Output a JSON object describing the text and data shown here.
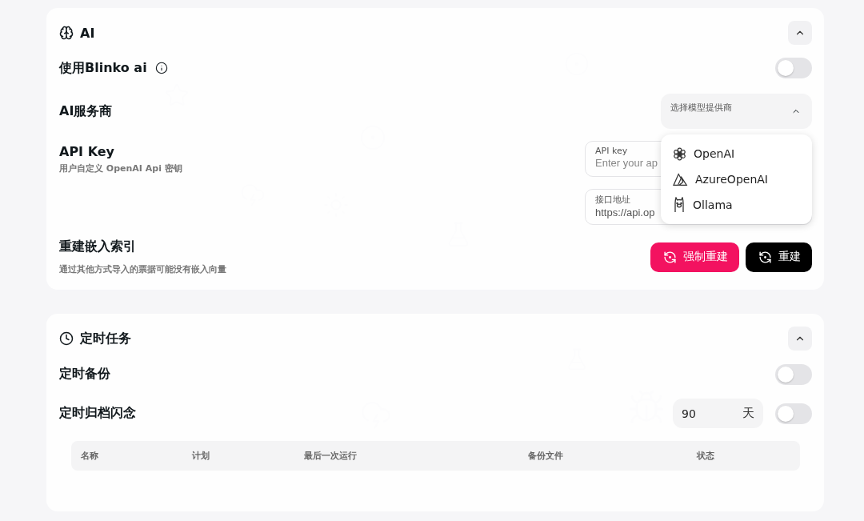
{
  "ai_section": {
    "title": "AI",
    "expanded": true,
    "use_blinko": {
      "label": "使用Blinko ai",
      "on": false
    },
    "provider": {
      "label": "AI服务商",
      "select_label": "选择模型提供商",
      "open": true,
      "options": [
        {
          "kind": "openai",
          "label": "OpenAI"
        },
        {
          "kind": "azure",
          "label": "AzureOpenAI"
        },
        {
          "kind": "ollama",
          "label": "Ollama"
        }
      ]
    },
    "api_key": {
      "label": "API Key",
      "description": "用户自定义 OpenAI Api 密钥",
      "key_field": {
        "label": "API key",
        "placeholder": "Enter your ap"
      },
      "endpoint_field": {
        "label": "接口地址",
        "value": "https://api.op"
      }
    },
    "rebuild": {
      "label": "重建嵌入索引",
      "description": "通过其他方式导入的票据可能没有嵌入向量",
      "buttons": [
        {
          "kind": "danger",
          "label": "强制重建"
        },
        {
          "kind": "dark",
          "label": "重建"
        }
      ]
    }
  },
  "tasks_section": {
    "title": "定时任务",
    "expanded": true,
    "rows": [
      {
        "kind": "toggle",
        "label": "定时备份",
        "on": false
      },
      {
        "kind": "days",
        "label": "定时归档闪念",
        "value": "90",
        "unit": "天",
        "on": false
      }
    ],
    "table": {
      "columns": [
        "名称",
        "计划",
        "最后一次运行",
        "备份文件",
        "状态"
      ]
    }
  }
}
